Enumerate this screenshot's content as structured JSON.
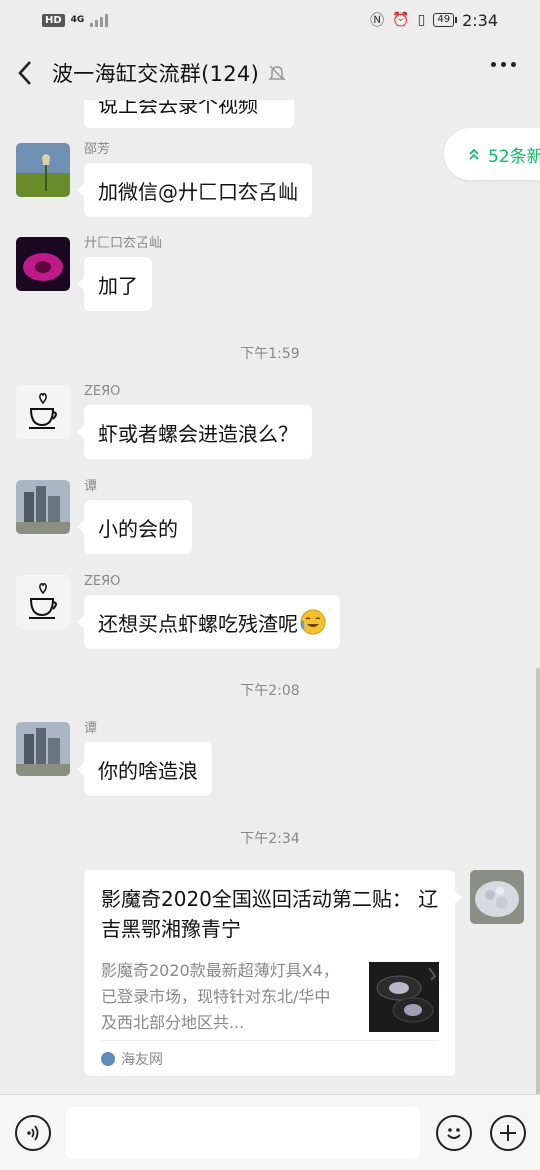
{
  "status_bar": {
    "hd": "HD",
    "network": "4G",
    "battery": "49",
    "time": "2:34"
  },
  "header": {
    "title": "波一海缸交流群(124)"
  },
  "partial_message": "说上会去录个视频",
  "new_messages": "52条新",
  "messages": [
    {
      "sender": "邵芳",
      "text": "加微信@廾匚口厺叾屾"
    },
    {
      "sender": "廾匚口厺叾屾",
      "text": "加了"
    },
    {
      "sender": "ZEЯO",
      "text": "虾或者螺会进造浪么？"
    },
    {
      "sender": "谭",
      "text": "小的会的"
    },
    {
      "sender": "ZEЯO",
      "text": "还想买点虾螺吃残渣呢"
    },
    {
      "sender": "谭",
      "text": "你的啥造浪"
    }
  ],
  "timestamps": [
    "下午1:59",
    "下午2:08",
    "下午2:34"
  ],
  "link_card": {
    "title": "影魔奇2020全国巡回活动第二贴： 辽吉黑鄂湘豫青宁",
    "description": "影魔奇2020款最新超薄灯具X4，已登录市场，现特针对东北/华中及西北部分地区共...",
    "source": "海友网"
  },
  "input": {
    "placeholder": ""
  },
  "colors": {
    "accent": "#07c160",
    "background": "#ededed",
    "bubble": "#ffffff"
  },
  "icons": [
    "back-icon",
    "mute-icon",
    "more-icon",
    "double-chevron-up-icon",
    "voice-icon",
    "emoji-icon",
    "plus-icon"
  ]
}
